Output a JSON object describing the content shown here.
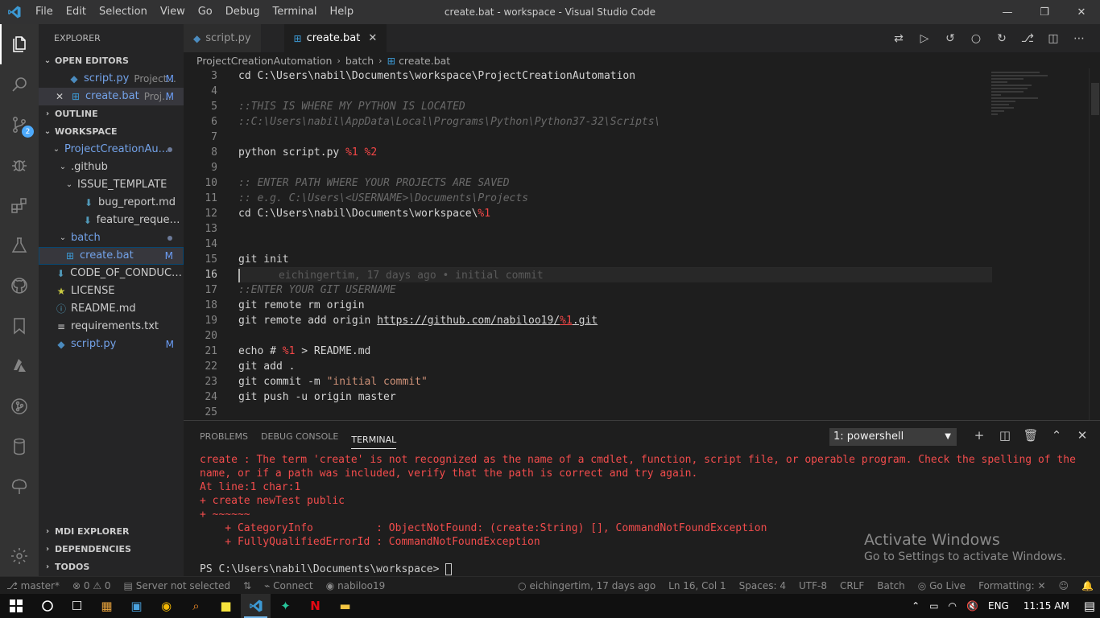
{
  "titlebar": {
    "menu": [
      "File",
      "Edit",
      "Selection",
      "View",
      "Go",
      "Debug",
      "Terminal",
      "Help"
    ],
    "title": "create.bat - workspace - Visual Studio Code"
  },
  "activity": {
    "scm_badge": "2"
  },
  "sidebar": {
    "header": "EXPLORER",
    "open_editors_label": "OPEN EDITORS",
    "open_editors": [
      {
        "name": "script.py",
        "desc": "Project...",
        "mark": "M"
      },
      {
        "name": "create.bat",
        "desc": "Proj...",
        "mark": "M"
      }
    ],
    "outline_label": "OUTLINE",
    "workspace_label": "WORKSPACE",
    "tree": {
      "root": "ProjectCreationAu...",
      "github": ".github",
      "issue_template": "ISSUE_TEMPLATE",
      "bug_report": "bug_report.md",
      "feature_request": "feature_request.md",
      "batch": "batch",
      "create": "create.bat",
      "create_mark": "M",
      "code_of_conduct": "CODE_OF_CONDUCT....",
      "license": "LICENSE",
      "readme": "README.md",
      "requirements": "requirements.txt",
      "script": "script.py",
      "script_mark": "M"
    },
    "bottom_sections": [
      "MDI EXPLORER",
      "DEPENDENCIES",
      "TODOS"
    ]
  },
  "tabs": [
    {
      "label": "script.py"
    },
    {
      "label": "create.bat"
    }
  ],
  "breadcrumb": [
    "ProjectCreationAutomation",
    "batch",
    "create.bat"
  ],
  "editor": {
    "line_numbers": [
      "3",
      "4",
      "5",
      "6",
      "7",
      "8",
      "9",
      "10",
      "11",
      "12",
      "13",
      "14",
      "15",
      "16",
      "17",
      "18",
      "19",
      "20",
      "21",
      "22",
      "23",
      "24",
      "25"
    ],
    "l3": "cd C:\\Users\\nabil\\Documents\\workspace\\ProjectCreationAutomation",
    "l5": "::THIS IS WHERE MY PYTHON IS LOCATED",
    "l6": "::C:\\Users\\nabil\\AppData\\Local\\Programs\\Python\\Python37-32\\Scripts\\",
    "l8a": "python script.py ",
    "l8b": "%1",
    "l8c": " ",
    "l8d": "%2",
    "l10": ":: ENTER PATH WHERE YOUR PROJECTS ARE SAVED",
    "l11": ":: e.g. C:\\Users\\<USERNAME>\\Documents\\Projects",
    "l12a": "cd C:\\Users\\nabil\\Documents\\workspace\\",
    "l12b": "%1",
    "l15": "git init",
    "l16": "eichingertim, 17 days ago • initial commit",
    "l17": "::ENTER YOUR GIT USERNAME",
    "l18": "git remote rm origin",
    "l19a": "git remote add origin ",
    "l19b": "https://github.com/nabiloo19/",
    "l19c": "%1",
    "l19d": ".git",
    "l21a": "echo # ",
    "l21b": "%1",
    "l21c": " > README.md",
    "l22": "git add .",
    "l23a": "git commit -m ",
    "l23b": "\"initial commit\"",
    "l24": "git push -u origin master"
  },
  "panel": {
    "tabs": [
      "PROBLEMS",
      "DEBUG CONSOLE",
      "TERMINAL"
    ],
    "terminal_select": "1: powershell",
    "lines": [
      "create : The term 'create' is not recognized as the name of a cmdlet, function, script file, or operable program. Check the spelling of the",
      "name, or if a path was included, verify that the path is correct and try again.",
      "At line:1 char:1",
      "+ create newTest public",
      "+ ~~~~~~",
      "    + CategoryInfo          : ObjectNotFound: (create:String) [], CommandNotFoundException",
      "    + FullyQualifiedErrorId : CommandNotFoundException"
    ],
    "prompt": "PS C:\\Users\\nabil\\Documents\\workspace> "
  },
  "watermark": {
    "line1": "Activate Windows",
    "line2": "Go to Settings to activate Windows."
  },
  "statusbar": {
    "branch": "master*",
    "problems": "0 ⚠ 0",
    "server": "Server not selected",
    "connect": "Connect",
    "user": "nabiloo19",
    "blame": "eichingertim, 17 days ago",
    "position": "Ln 16, Col 1",
    "spaces": "Spaces: 4",
    "encoding": "UTF-8",
    "eol": "CRLF",
    "language": "Batch",
    "golive": "Go Live",
    "formatting": "Formatting: ✕"
  },
  "taskbar": {
    "lang": "ENG",
    "time": "11:15 AM"
  },
  "colors": {
    "accent": "#007acc",
    "error": "#f14c4c",
    "modified": "#73a2e8"
  }
}
